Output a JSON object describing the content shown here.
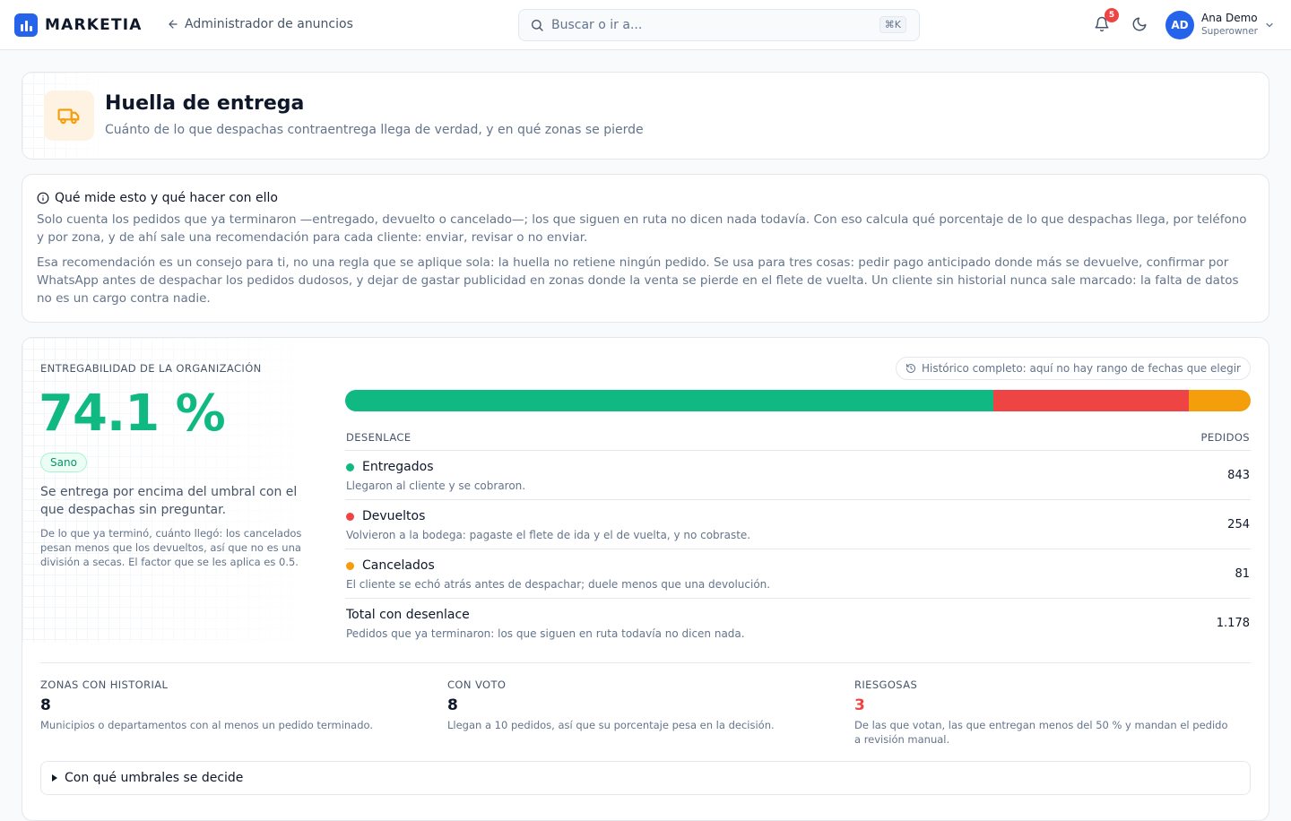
{
  "topbar": {
    "brand": "MARKETIA",
    "back_label": "Administrador de anuncios",
    "search_placeholder": "Buscar o ir a...",
    "search_shortcut": "⌘K",
    "notifications_count": "5",
    "user": {
      "initials": "AD",
      "name": "Ana Demo",
      "role": "Superowner"
    }
  },
  "header": {
    "title": "Huella de entrega",
    "subtitle": "Cuánto de lo que despachas contraentrega llega de verdad, y en qué zonas se pierde"
  },
  "info": {
    "title": "Qué mide esto y qué hacer con ello",
    "paragraph1": "Solo cuenta los pedidos que ya terminaron —entregado, devuelto o cancelado—; los que siguen en ruta no dicen nada todavía. Con eso calcula qué porcentaje de lo que despachas llega, por teléfono y por zona, y de ahí sale una recomendación para cada cliente: enviar, revisar o no enviar.",
    "paragraph2": "Esa recomendación es un consejo para ti, no una regla que se aplique sola: la huella no retiene ningún pedido. Se usa para tres cosas: pedir pago anticipado donde más se devuelve, confirmar por WhatsApp antes de despachar los pedidos dudosos, y dejar de gastar publicidad en zonas donde la venta se pierde en el flete de vuelta. Un cliente sin historial nunca sale marcado: la falta de datos no es un cargo contra nadie."
  },
  "kpi": {
    "label": "ENTREGABILIDAD DE LA ORGANIZACIÓN",
    "value": "74.1 %",
    "badge": "Sano",
    "description": "Se entrega por encima del umbral con el que despachas sin preguntar.",
    "note": "De lo que ya terminó, cuánto llegó: los cancelados pesan menos que los devueltos, así que no es una división a secas. El factor que se les aplica es 0.5."
  },
  "history_pill": "Histórico completo: aquí no hay rango de fechas que elegir",
  "colors": {
    "delivered": "#10b981",
    "returned": "#ef4444",
    "cancelled": "#f59e0b",
    "accent": "#2563eb"
  },
  "outcomes": {
    "header_left": "DESENLACE",
    "header_right": "PEDIDOS",
    "rows": [
      {
        "label": "Entregados",
        "description": "Llegaron al cliente y se cobraron.",
        "value": "843",
        "count": 843,
        "color": "#10b981"
      },
      {
        "label": "Devueltos",
        "description": "Volvieron a la bodega: pagaste el flete de ida y el de vuelta, y no cobraste.",
        "value": "254",
        "count": 254,
        "color": "#ef4444"
      },
      {
        "label": "Cancelados",
        "description": "El cliente se echó atrás antes de despachar; duele menos que una devolución.",
        "value": "81",
        "count": 81,
        "color": "#f59e0b"
      }
    ],
    "total": {
      "label": "Total con desenlace",
      "description": "Pedidos que ya terminaron: los que siguen en ruta todavía no dicen nada.",
      "value": "1.178"
    }
  },
  "stats": [
    {
      "label": "ZONAS CON HISTORIAL",
      "value": "8",
      "description": "Municipios o departamentos con al menos un pedido terminado."
    },
    {
      "label": "CON VOTO",
      "value": "8",
      "description": "Llegan a 10 pedidos, así que su porcentaje pesa en la decisión."
    },
    {
      "label": "RIESGOSAS",
      "value": "3",
      "description": "De las que votan, las que entregan menos del 50 % y mandan el pedido a revisión manual."
    }
  ],
  "details_label": "Con qué umbrales se decide"
}
